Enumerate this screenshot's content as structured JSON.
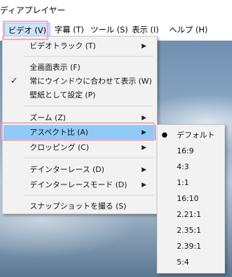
{
  "window": {
    "title": "ディアプレイヤー"
  },
  "menubar": {
    "items": [
      {
        "label": "ビデオ (V)"
      },
      {
        "label": "字幕 (T)"
      },
      {
        "label": "ツール (S)"
      },
      {
        "label": "表示 (I)"
      },
      {
        "label": "ヘルプ (H)"
      }
    ]
  },
  "video_menu": {
    "items": [
      {
        "label": "ビデオトラック (T)",
        "submenu": true
      },
      {
        "label": "全画面表示 (F)"
      },
      {
        "label": "常にウインドウに合わせて表示 (W)",
        "checked": true
      },
      {
        "label": "壁紙として設定 (P)"
      },
      {
        "label": "ズーム (Z)",
        "submenu": true
      },
      {
        "label": "アスペクト比 (A)",
        "submenu": true,
        "highlighted": true
      },
      {
        "label": "クロッピング (C)",
        "submenu": true
      },
      {
        "label": "デインターレース (D)",
        "submenu": true
      },
      {
        "label": "デインターレースモード (D)",
        "submenu": true
      },
      {
        "label": "スナップショットを撮る (S)"
      }
    ]
  },
  "aspect_submenu": {
    "items": [
      {
        "label": "デフォルト",
        "selected": true
      },
      {
        "label": "16:9"
      },
      {
        "label": "4:3"
      },
      {
        "label": "1:1"
      },
      {
        "label": "16:10"
      },
      {
        "label": "2.21:1"
      },
      {
        "label": "2.35:1"
      },
      {
        "label": "2.39:1"
      },
      {
        "label": "5:4"
      }
    ]
  },
  "icons": {
    "submenu_arrow": "▶",
    "check": "✓",
    "radio_bullet": "●"
  },
  "colors": {
    "menu_hover": "#91c9f7",
    "annotation_box": "#f4a7c0"
  }
}
